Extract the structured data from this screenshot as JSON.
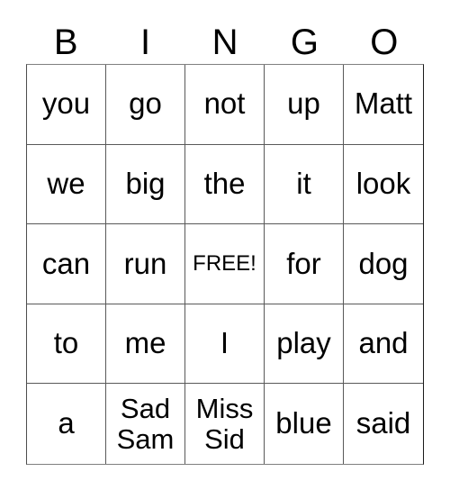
{
  "card": {
    "headers": [
      "B",
      "I",
      "N",
      "G",
      "O"
    ],
    "rows": [
      [
        {
          "text": "you",
          "free": false,
          "multiline": false
        },
        {
          "text": "go",
          "free": false,
          "multiline": false
        },
        {
          "text": "not",
          "free": false,
          "multiline": false
        },
        {
          "text": "up",
          "free": false,
          "multiline": false
        },
        {
          "text": "Matt",
          "free": false,
          "multiline": false
        }
      ],
      [
        {
          "text": "we",
          "free": false,
          "multiline": false
        },
        {
          "text": "big",
          "free": false,
          "multiline": false
        },
        {
          "text": "the",
          "free": false,
          "multiline": false
        },
        {
          "text": "it",
          "free": false,
          "multiline": false
        },
        {
          "text": "look",
          "free": false,
          "multiline": false
        }
      ],
      [
        {
          "text": "can",
          "free": false,
          "multiline": false
        },
        {
          "text": "run",
          "free": false,
          "multiline": false
        },
        {
          "text": "FREE!",
          "free": true,
          "multiline": false
        },
        {
          "text": "for",
          "free": false,
          "multiline": false
        },
        {
          "text": "dog",
          "free": false,
          "multiline": false
        }
      ],
      [
        {
          "text": "to",
          "free": false,
          "multiline": false
        },
        {
          "text": "me",
          "free": false,
          "multiline": false
        },
        {
          "text": "I",
          "free": false,
          "multiline": false
        },
        {
          "text": "play",
          "free": false,
          "multiline": false
        },
        {
          "text": "and",
          "free": false,
          "multiline": false
        }
      ],
      [
        {
          "text": "a",
          "free": false,
          "multiline": false
        },
        {
          "text": "Sad\nSam",
          "free": false,
          "multiline": true
        },
        {
          "text": "Miss\nSid",
          "free": false,
          "multiline": true
        },
        {
          "text": "blue",
          "free": false,
          "multiline": false
        },
        {
          "text": "said",
          "free": false,
          "multiline": false
        }
      ]
    ],
    "colors": {
      "background": "#ffffff",
      "text": "#000000",
      "grid_line": "#595959"
    }
  }
}
